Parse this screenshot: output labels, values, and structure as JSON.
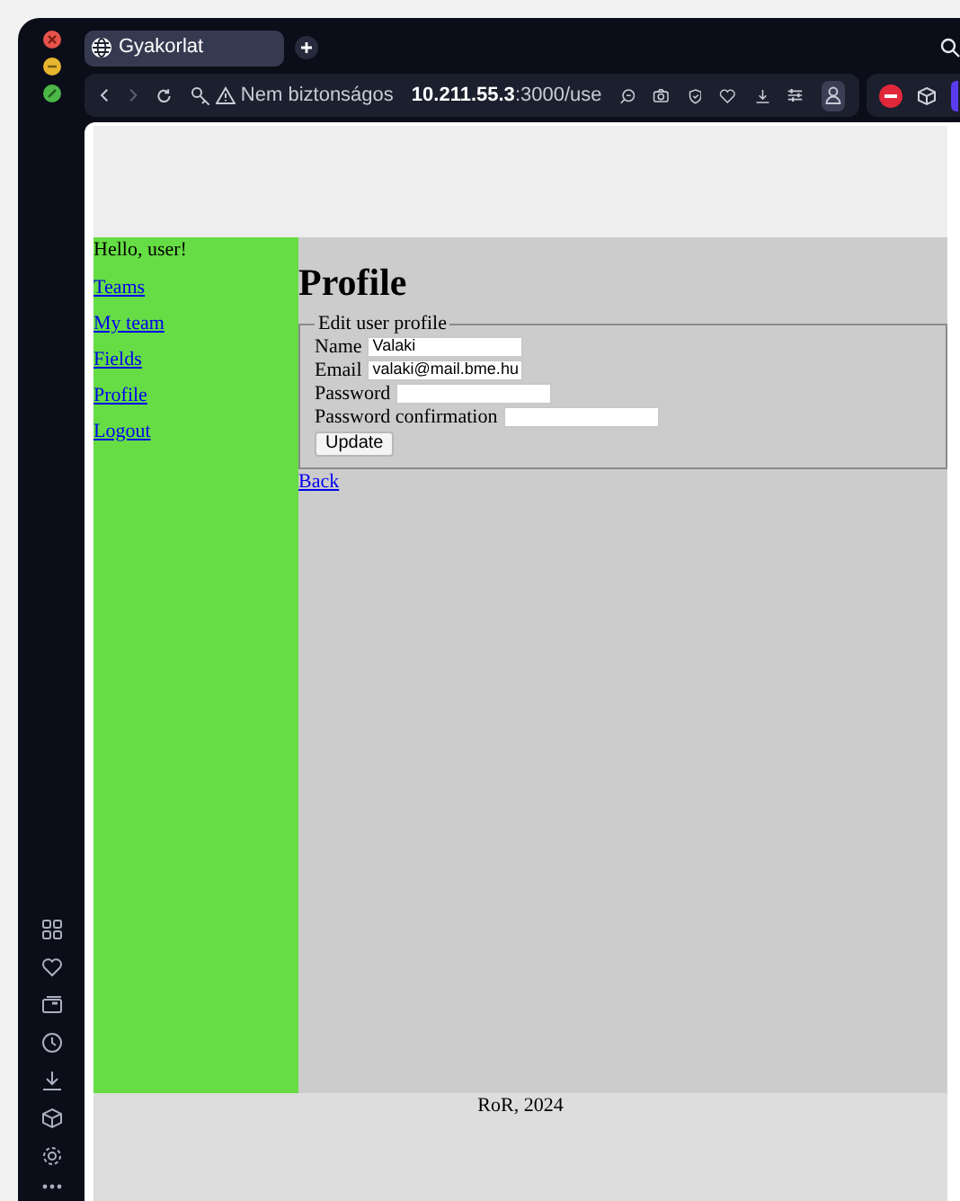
{
  "browser": {
    "tabs": [
      {
        "title": "Gyakorlat",
        "selected": true
      }
    ],
    "address_bar": {
      "security_label": "Nem biztonságos",
      "host": "10.211.55.3",
      "path": ":3000/use"
    }
  },
  "page": {
    "greeting": "Hello, user!",
    "nav": [
      {
        "label": "Teams"
      },
      {
        "label": "My team"
      },
      {
        "label": "Fields"
      },
      {
        "label": "Profile"
      },
      {
        "label": "Logout"
      }
    ],
    "heading": "Profile",
    "form": {
      "legend": "Edit user profile",
      "fields": [
        {
          "label": "Name",
          "value": "Valaki"
        },
        {
          "label": "Email",
          "value": "valaki@mail.bme.hu"
        },
        {
          "label": "Password"
        },
        {
          "label": "Password confirmation"
        }
      ],
      "submit": "Update"
    },
    "back_link": "Back",
    "footer": "RoR, 2024"
  }
}
